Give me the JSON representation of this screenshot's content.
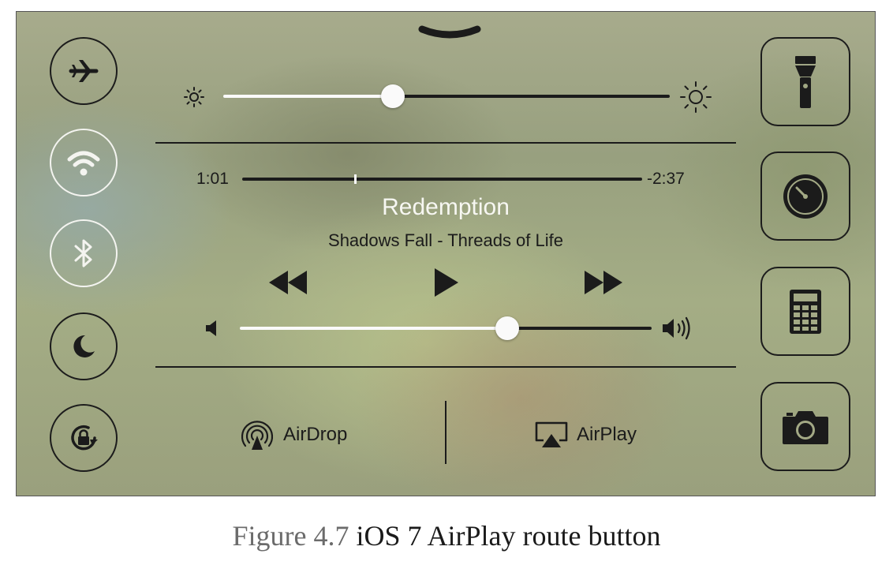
{
  "control_center": {
    "toggles": [
      {
        "name": "airplane",
        "icon": "airplane-icon",
        "active": false
      },
      {
        "name": "wifi",
        "icon": "wifi-icon",
        "active": true
      },
      {
        "name": "bluetooth",
        "icon": "bluetooth-icon",
        "active": true
      },
      {
        "name": "do-not-disturb",
        "icon": "moon-icon",
        "active": false
      },
      {
        "name": "rotation-lock",
        "icon": "rotation-lock-icon",
        "active": false
      }
    ],
    "brightness": {
      "level": 0.38
    },
    "now_playing": {
      "elapsed": "1:01",
      "remaining": "-2:37",
      "progress": 0.28,
      "title": "Redemption",
      "artist_album": "Shadows Fall - Threads of Life"
    },
    "volume": {
      "level": 0.65
    },
    "airdrop_label": "AirDrop",
    "airplay_label": "AirPlay",
    "shortcuts": [
      {
        "name": "flashlight",
        "icon": "flashlight-icon"
      },
      {
        "name": "timer",
        "icon": "timer-icon"
      },
      {
        "name": "calculator",
        "icon": "calculator-icon"
      },
      {
        "name": "camera",
        "icon": "camera-icon"
      }
    ],
    "colors": {
      "active_ring": "#f4f4f0",
      "ink": "#1b1b1b",
      "thumb": "#fafafa"
    }
  },
  "caption": {
    "figure_number": "Figure 4.7",
    "text": "iOS 7 AirPlay route button"
  }
}
